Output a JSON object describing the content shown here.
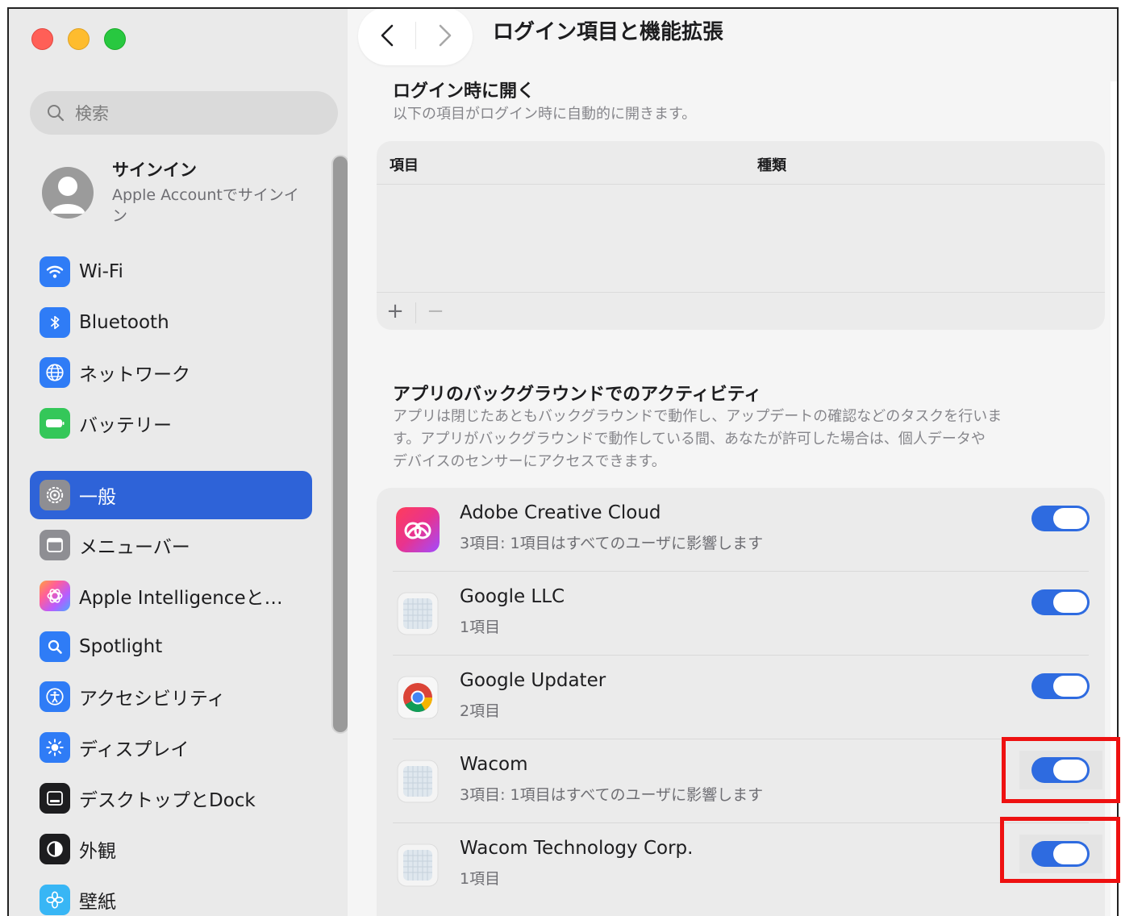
{
  "sidebar": {
    "search_placeholder": "検索",
    "account": {
      "title": "サインイン",
      "subtitle": "Apple Accountでサインイン"
    },
    "items": [
      {
        "label": "Wi-Fi",
        "icon": "wifi-icon",
        "color": "#2f7cf6"
      },
      {
        "label": "Bluetooth",
        "icon": "bluetooth-icon",
        "color": "#2f7cf6"
      },
      {
        "label": "ネットワーク",
        "icon": "globe-icon",
        "color": "#2f7cf6"
      },
      {
        "label": "バッテリー",
        "icon": "battery-icon",
        "color": "#34c759"
      },
      {
        "label": "一般",
        "icon": "gear-icon",
        "color": "#8e8e93",
        "selected": true
      },
      {
        "label": "メニューバー",
        "icon": "menubar-icon",
        "color": "#8e8e93"
      },
      {
        "label": "Apple Intelligenceと…",
        "icon": "apple-intelligence-icon",
        "color": "#e06fd8"
      },
      {
        "label": "Spotlight",
        "icon": "spotlight-icon",
        "color": "#2f7cf6"
      },
      {
        "label": "アクセシビリティ",
        "icon": "accessibility-icon",
        "color": "#2f7cf6"
      },
      {
        "label": "ディスプレイ",
        "icon": "display-icon",
        "color": "#2f7cf6"
      },
      {
        "label": "デスクトップとDock",
        "icon": "dock-icon",
        "color": "#1d1d1f"
      },
      {
        "label": "外観",
        "icon": "appearance-icon",
        "color": "#1d1d1f"
      },
      {
        "label": "壁紙",
        "icon": "wallpaper-icon",
        "color": "#38b6f5"
      }
    ]
  },
  "main": {
    "title": "ログイン項目と機能拡張",
    "login": {
      "title": "ログイン時に開く",
      "description": "以下の項目がログイン時に自動的に開きます。",
      "columns": [
        "項目",
        "種類"
      ],
      "add": "+",
      "remove": "−"
    },
    "background": {
      "title": "アプリのバックグラウンドでのアクティビティ",
      "description_lines": [
        "アプリは閉じたあともバックグラウンドで動作し、アップデートの確認などのタスクを行いま",
        "す。アプリがバックグラウンドで動作している間、あなたが許可した場合は、個人データや",
        "デバイスのセンサーにアクセスできます。"
      ],
      "apps": [
        {
          "name": "Adobe Creative Cloud",
          "detail": "3項目: 1項目はすべてのユーザに影響します",
          "enabled": true,
          "icon": "adobe-cc-icon"
        },
        {
          "name": "Google LLC",
          "detail": "1項目",
          "enabled": true,
          "icon": "generic-app-icon"
        },
        {
          "name": "Google Updater",
          "detail": "2項目",
          "enabled": true,
          "icon": "chrome-icon"
        },
        {
          "name": "Wacom",
          "detail": "3項目: 1項目はすべてのユーザに影響します",
          "enabled": true,
          "icon": "generic-app-icon"
        },
        {
          "name": "Wacom Technology Corp.",
          "detail": "1項目",
          "enabled": true,
          "icon": "generic-app-icon"
        }
      ]
    }
  },
  "colors": {
    "accent": "#2e63d8",
    "toggle_on": "#2e6be0",
    "highlight": "#ee1111"
  }
}
